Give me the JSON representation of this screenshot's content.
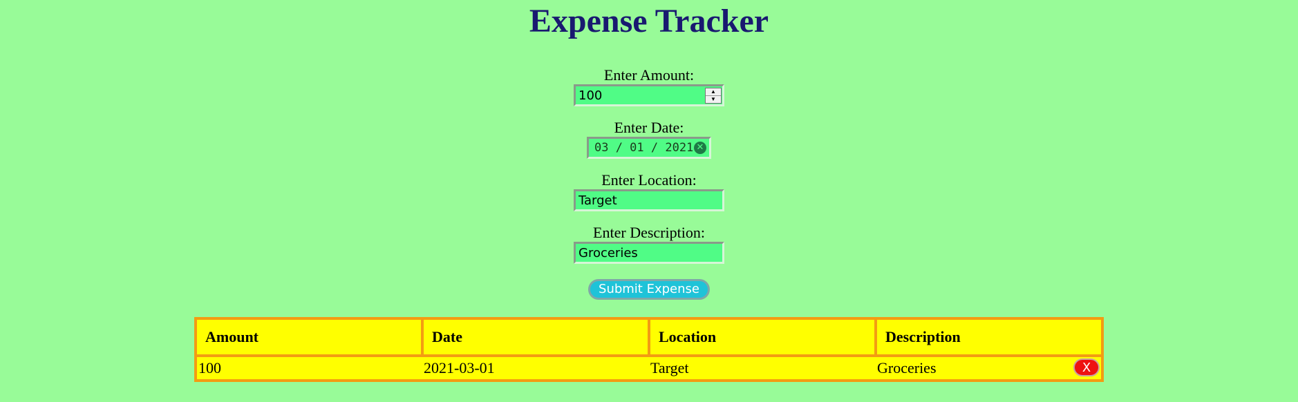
{
  "title": "Expense Tracker",
  "form": {
    "amount": {
      "label": "Enter Amount:",
      "value": "100"
    },
    "date": {
      "label": "Enter Date:",
      "value": "03 / 01 / 2021"
    },
    "location": {
      "label": "Enter Location:",
      "value": "Target"
    },
    "description": {
      "label": "Enter Description:",
      "value": "Groceries"
    },
    "submit_label": "Submit Expense"
  },
  "table": {
    "headers": [
      "Amount",
      "Date",
      "Location",
      "Description"
    ],
    "rows": [
      {
        "amount": "100",
        "date": "2021-03-01",
        "location": "Target",
        "description": "Groceries",
        "delete_label": "X"
      }
    ]
  },
  "colors": {
    "background": "#98fb98",
    "title": "#191970",
    "input_bg": "#50fc86",
    "submit_bg": "#1fc3d8",
    "table_bg": "#ffff00",
    "table_border": "#f39c12",
    "delete_bg": "#ee1111"
  },
  "icons": {
    "stepper_up": "caret-up-icon",
    "stepper_down": "caret-down-icon",
    "date_clear": "clear-circle-icon"
  }
}
